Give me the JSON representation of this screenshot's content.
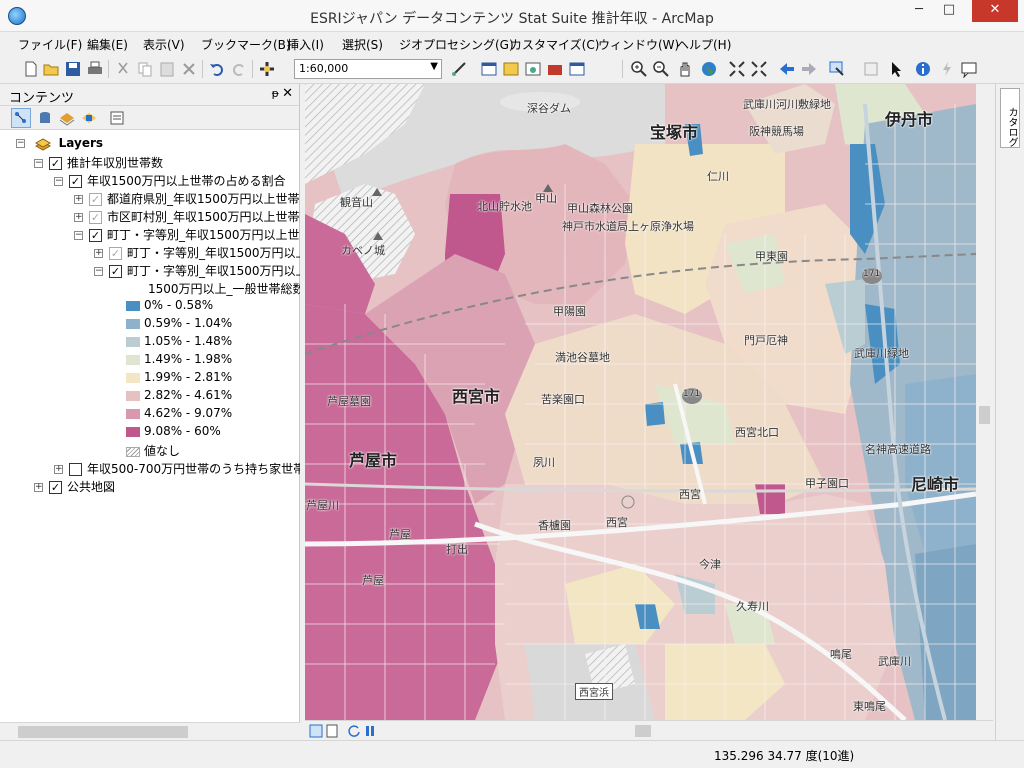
{
  "window": {
    "title": "ESRIジャパン データコンテンツ Stat Suite 推計年収 - ArcMap",
    "min": "─",
    "max": "□",
    "close": "✕"
  },
  "menu": [
    "ファイル(F)",
    "編集(E)",
    "表示(V)",
    "ブックマーク(B)",
    "挿入(I)",
    "選択(S)",
    "ジオプロセシング(G)",
    "カスタマイズ(C)",
    "ウィンドウ(W)",
    "ヘルプ(H)"
  ],
  "toolbar": {
    "scale": "1:60,000"
  },
  "toc": {
    "title": "コンテンツ",
    "pin": "ᵽ",
    "close": "✕",
    "layers": "Layers",
    "group1": "推計年収別世帯数",
    "sub1": "年収1500万円以上世帯の占める割合",
    "l_pref": "都道府県別_年収1500万円以上世帯",
    "l_city": "市区町村別_年収1500万円以上世帯",
    "l_town": "町丁・字等別_年収1500万円以上世",
    "l_town2": "町丁・字等別_年収1500万円以上",
    "l_town3": "町丁・字等別_年収1500万円以上",
    "field": "1500万円以上_一般世帯総数",
    "legend": [
      {
        "label": "0% - 0.58%",
        "color": "#4a8fc2"
      },
      {
        "label": "0.59% - 1.04%",
        "color": "#8fb2cc"
      },
      {
        "label": "1.05% - 1.48%",
        "color": "#b9cdd3"
      },
      {
        "label": "1.49% - 1.98%",
        "color": "#dfe6cf"
      },
      {
        "label": "1.99% - 2.81%",
        "color": "#f3e6c4"
      },
      {
        "label": "2.82% - 4.61%",
        "color": "#e7c0c2"
      },
      {
        "label": "4.62% - 9.07%",
        "color": "#d998ae"
      },
      {
        "label": "9.08% - 60%",
        "color": "#c0588e"
      }
    ],
    "nodata": "値なし",
    "group2": "年収500-700万円世帯のうち持ち家世帯(",
    "basemap": "公共地図"
  },
  "map": {
    "labels": {
      "takarazuka": "宝塚市",
      "itami": "伊丹市",
      "nishinomiya": "西宮市",
      "ashiya": "芦屋市",
      "amagasaki": "尼崎市",
      "fukatani": "深谷ダム",
      "mukogawa": "武庫川河川敷緑地",
      "hanshin": "阪神競馬場",
      "niegawa": "仁川",
      "kannon": "観音山",
      "kitayama": "北山貯水池",
      "kabuto": "甲山",
      "kabutoyama": "甲山森林公園",
      "kobe": "神戸市水道局上ヶ原浄水場",
      "kabenoshiro": "カベノ城",
      "koto": "甲東園",
      "koyo": "甲陽園",
      "mantake": "満池谷墓地",
      "mondo": "門戸厄神",
      "mukogawa2": "武庫川緑地",
      "ashiyabochi": "芦屋墓園",
      "kuraku": "苦楽園口",
      "shukugawa": "夙川",
      "nishinomiyakitaguchi": "西宮北口",
      "koshienguchi": "甲子園口",
      "nishinomiya2": "西宮",
      "nishinomiya3": "西宮",
      "kogaen": "香櫨園",
      "ashiyagawa": "芦屋川",
      "ashiya2": "芦屋",
      "ashiya3": "芦屋",
      "uchide": "打出",
      "imazu": "今津",
      "kuzugawa": "久寿川",
      "narao": "鳴尾",
      "mukogawa3": "武庫川",
      "higashinarao": "東鳴尾",
      "nishinomiyahama": "西宮浜",
      "expressway": "名神高速道路",
      "route171a": "171",
      "route171b": "171"
    }
  },
  "catalog": {
    "label": "カタログ"
  },
  "status": {
    "coord": "135.296  34.77 度(10進)"
  }
}
